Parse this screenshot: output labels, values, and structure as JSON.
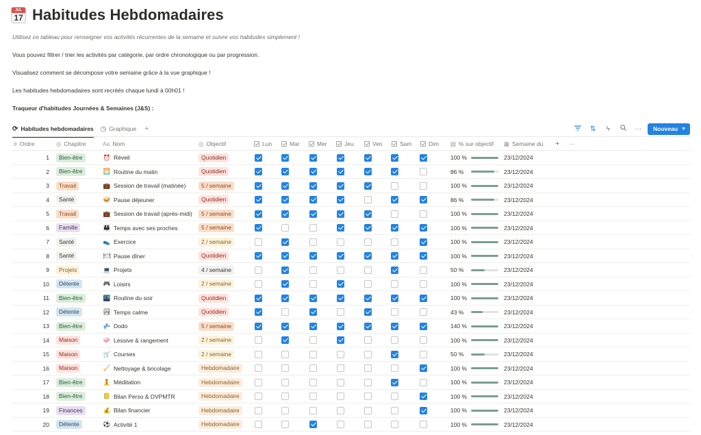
{
  "page": {
    "icon_month": "JUL",
    "icon_day": "17",
    "title": "Habitudes Hebdomadaires",
    "desc_intro": "Utilisez ce tableau pour renseigner vos activités récurrentes de la semaine et suivre vos habitudes simplement !",
    "desc_filter": "Vous pouvez filtrer / trier les activités par catégorie, par ordre chronologique ou par progression.",
    "desc_graph": "Visualisez comment se décompose votre semaine grâce à la vue graphique !",
    "desc_reset": "Les habitudes hebdomadaires sont recréés chaque lundi à 00h01 !",
    "desc_tracker": "Traqueur d'habitudes Journées & Semaines (J&S) :"
  },
  "views": {
    "tab_weekly": "Habitudes hebdomadaires",
    "tab_graph": "Graphique",
    "add_view": "+",
    "new_button": "Nouveau"
  },
  "columns": {
    "ordre": "Ordre",
    "chapitre": "Chapitre",
    "nom": "Nom",
    "objectif": "Objectif",
    "days": [
      "Lun",
      "Mar",
      "Mer",
      "Jeu",
      "Ven",
      "Sam",
      "Dim"
    ],
    "pct": "% sur objectif",
    "semaine": "Semaine du",
    "add": "+",
    "more": "···"
  },
  "colors": {
    "accent": "#2383e2",
    "progress": "#7a9e8f",
    "chapter": {
      "Bien-être": {
        "bg": "#dbeddb",
        "fg": "#2b593f"
      },
      "Travail": {
        "bg": "#fadec9",
        "fg": "#854c1d"
      },
      "Santé": {
        "bg": "#f1f1ef",
        "fg": "#37352f"
      },
      "Famille": {
        "bg": "#e8deee",
        "fg": "#492f64"
      },
      "Projets": {
        "bg": "#fbf3db",
        "fg": "#89632a"
      },
      "Détente": {
        "bg": "#d3e5ef",
        "fg": "#28456c"
      },
      "Maison": {
        "bg": "#ffe2dd",
        "fg": "#8a2e23"
      },
      "Finances": {
        "bg": "#e8deee",
        "fg": "#492f64"
      }
    },
    "objective": {
      "Quotidien": {
        "bg": "#ffe2dd",
        "fg": "#8a2e23"
      },
      "5 / semaine": {
        "bg": "#fadec9",
        "fg": "#854c1d"
      },
      "2 / semaine": {
        "bg": "#fbf3db",
        "fg": "#89632a"
      },
      "4 / semaine": {
        "bg": "#f1f1ef",
        "fg": "#37352f"
      },
      "Hebdomadaire": {
        "bg": "#fbecdd",
        "fg": "#89632a"
      }
    }
  },
  "rows": [
    {
      "ordre": "1",
      "chapitre": "Bien-être",
      "icon": "alarm-clock-icon",
      "glyph": "⏰",
      "nom": "Réveil",
      "objectif": "Quotidien",
      "days": [
        1,
        1,
        1,
        1,
        1,
        1,
        1
      ],
      "pct_label": "100 %",
      "pct": 100,
      "semaine": "23/12/2024"
    },
    {
      "ordre": "2",
      "chapitre": "Bien-être",
      "icon": "sunrise-icon",
      "glyph": "🌅",
      "nom": "Routine du matin",
      "objectif": "Quotidien",
      "days": [
        1,
        1,
        1,
        1,
        1,
        1,
        0
      ],
      "pct_label": "86 %",
      "pct": 86,
      "semaine": "23/12/2024"
    },
    {
      "ordre": "3",
      "chapitre": "Travail",
      "icon": "briefcase-icon",
      "glyph": "💼",
      "nom": "Session de travail (matinée)",
      "objectif": "5 / semaine",
      "days": [
        1,
        1,
        1,
        1,
        1,
        0,
        0
      ],
      "pct_label": "100 %",
      "pct": 100,
      "semaine": "23/12/2024"
    },
    {
      "ordre": "4",
      "chapitre": "Santé",
      "icon": "sandwich-icon",
      "glyph": "🥪",
      "nom": "Pause déjeuner",
      "objectif": "Quotidien",
      "days": [
        1,
        1,
        1,
        1,
        0,
        1,
        1
      ],
      "pct_label": "86 %",
      "pct": 86,
      "semaine": "23/12/2024"
    },
    {
      "ordre": "5",
      "chapitre": "Travail",
      "icon": "briefcase-icon",
      "glyph": "💼",
      "nom": "Session de travail (après-midi)",
      "objectif": "5 / semaine",
      "days": [
        1,
        1,
        1,
        1,
        1,
        0,
        0
      ],
      "pct_label": "100 %",
      "pct": 100,
      "semaine": "23/12/2024"
    },
    {
      "ordre": "6",
      "chapitre": "Famille",
      "icon": "people-icon",
      "glyph": "👪",
      "nom": "Temps avec ses proches",
      "objectif": "5 / semaine",
      "days": [
        1,
        0,
        0,
        1,
        1,
        1,
        1
      ],
      "pct_label": "100 %",
      "pct": 100,
      "semaine": "23/12/2024"
    },
    {
      "ordre": "7",
      "chapitre": "Santé",
      "icon": "sneaker-icon",
      "glyph": "👟",
      "nom": "Exercice",
      "objectif": "2 / semaine",
      "days": [
        0,
        1,
        0,
        0,
        0,
        0,
        1
      ],
      "pct_label": "100 %",
      "pct": 100,
      "semaine": "23/12/2024"
    },
    {
      "ordre": "8",
      "chapitre": "Santé",
      "icon": "plate-icon",
      "glyph": "🍽",
      "nom": "Pause dîner",
      "objectif": "Quotidien",
      "days": [
        1,
        1,
        1,
        1,
        1,
        1,
        1
      ],
      "pct_label": "100 %",
      "pct": 100,
      "semaine": "23/12/2024"
    },
    {
      "ordre": "9",
      "chapitre": "Projets",
      "icon": "laptop-icon",
      "glyph": "💻",
      "nom": "Projets",
      "objectif": "4 / semaine",
      "days": [
        0,
        1,
        0,
        0,
        0,
        1,
        0
      ],
      "pct_label": "50 %",
      "pct": 50,
      "semaine": "23/12/2024"
    },
    {
      "ordre": "10",
      "chapitre": "Détente",
      "icon": "gamepad-icon",
      "glyph": "🎮",
      "nom": "Loisirs",
      "objectif": "2 / semaine",
      "days": [
        0,
        1,
        0,
        1,
        0,
        0,
        0
      ],
      "pct_label": "100 %",
      "pct": 100,
      "semaine": "23/12/2024"
    },
    {
      "ordre": "11",
      "chapitre": "Bien-être",
      "icon": "night-city-icon",
      "glyph": "🌃",
      "nom": "Routine du soir",
      "objectif": "Quotidien",
      "days": [
        1,
        1,
        1,
        1,
        1,
        1,
        1
      ],
      "pct_label": "100 %",
      "pct": 100,
      "semaine": "23/12/2024"
    },
    {
      "ordre": "12",
      "chapitre": "Détente",
      "icon": "picture-icon",
      "glyph": "🏞",
      "nom": "Temps calme",
      "objectif": "Quotidien",
      "days": [
        1,
        0,
        1,
        0,
        1,
        0,
        0
      ],
      "pct_label": "43 %",
      "pct": 43,
      "semaine": "23/12/2024"
    },
    {
      "ordre": "13",
      "chapitre": "Bien-être",
      "icon": "sleep-icon",
      "glyph": "💤",
      "nom": "Dodo",
      "objectif": "5 / semaine",
      "days": [
        1,
        1,
        1,
        1,
        1,
        1,
        1
      ],
      "pct_label": "140 %",
      "pct": 140,
      "semaine": "23/12/2024"
    },
    {
      "ordre": "14",
      "chapitre": "Maison",
      "icon": "soap-icon",
      "glyph": "🧼",
      "nom": "Lessive & rangement",
      "objectif": "2 / semaine",
      "days": [
        0,
        1,
        0,
        1,
        0,
        0,
        0
      ],
      "pct_label": "100 %",
      "pct": 100,
      "semaine": "23/12/2024"
    },
    {
      "ordre": "15",
      "chapitre": "Maison",
      "icon": "cart-icon",
      "glyph": "🛒",
      "nom": "Courses",
      "objectif": "2 / semaine",
      "days": [
        0,
        0,
        0,
        0,
        0,
        1,
        0
      ],
      "pct_label": "50 %",
      "pct": 50,
      "semaine": "23/12/2024"
    },
    {
      "ordre": "16",
      "chapitre": "Maison",
      "icon": "broom-icon",
      "glyph": "🧹",
      "nom": "Nettoyage & bricolage",
      "objectif": "Hebdomadaire",
      "days": [
        0,
        0,
        0,
        0,
        0,
        0,
        1
      ],
      "pct_label": "100 %",
      "pct": 100,
      "semaine": "23/12/2024"
    },
    {
      "ordre": "17",
      "chapitre": "Bien-être",
      "icon": "meditation-icon",
      "glyph": "🧘",
      "nom": "Méditation",
      "objectif": "Hebdomadaire",
      "days": [
        0,
        0,
        0,
        0,
        0,
        1,
        0
      ],
      "pct_label": "100 %",
      "pct": 100,
      "semaine": "23/12/2024"
    },
    {
      "ordre": "18",
      "chapitre": "Bien-être",
      "icon": "notebook-icon",
      "glyph": "📒",
      "nom": "Bilan Perso & DVPMTR",
      "objectif": "Hebdomadaire",
      "days": [
        0,
        0,
        0,
        0,
        0,
        0,
        1
      ],
      "pct_label": "100 %",
      "pct": 100,
      "semaine": "23/12/2024"
    },
    {
      "ordre": "19",
      "chapitre": "Finances",
      "icon": "money-bag-icon",
      "glyph": "💰",
      "nom": "Bilan financier",
      "objectif": "Hebdomadaire",
      "days": [
        0,
        0,
        0,
        0,
        0,
        0,
        1
      ],
      "pct_label": "100 %",
      "pct": 100,
      "semaine": "23/12/2024"
    },
    {
      "ordre": "20",
      "chapitre": "Détente",
      "icon": "soccer-ball-icon",
      "glyph": "⚽",
      "nom": "Activité 1",
      "objectif": "Hebdomadaire",
      "days": [
        0,
        0,
        1,
        0,
        0,
        0,
        0
      ],
      "pct_label": "100 %",
      "pct": 100,
      "semaine": "23/12/2024"
    }
  ]
}
